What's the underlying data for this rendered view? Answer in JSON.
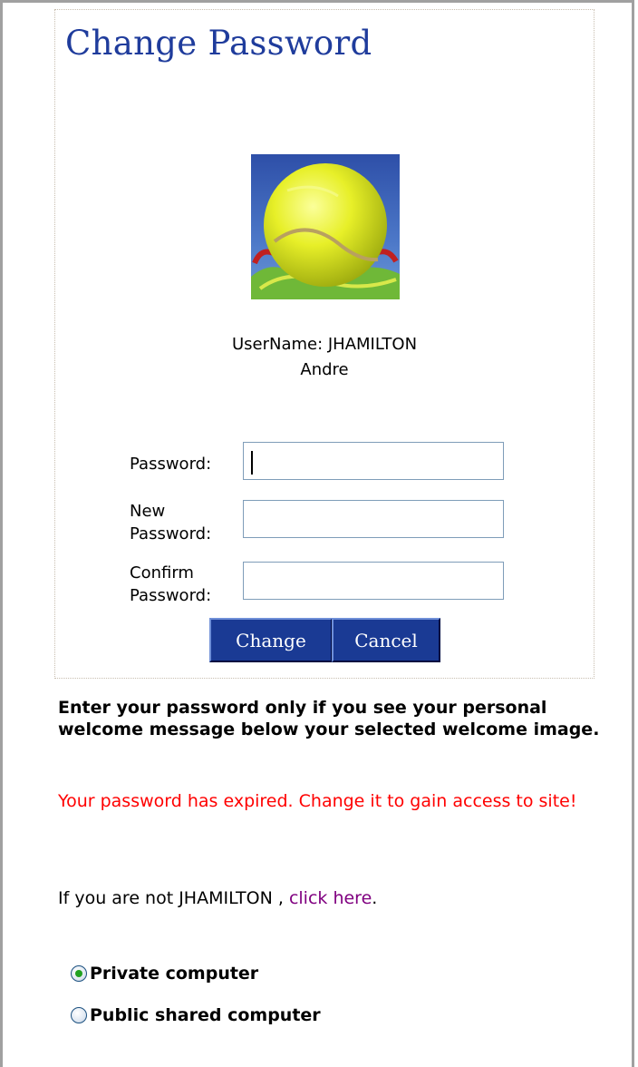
{
  "page": {
    "title": "Change Password"
  },
  "welcome": {
    "image_icon": "tennis-ball-image",
    "username_line": "UserName: JHAMILTON",
    "fullname": "Andre"
  },
  "form": {
    "password_label": "Password:",
    "new_password_label_1": "New",
    "new_password_label_2": "Password:",
    "confirm_password_label_1": "Confirm",
    "confirm_password_label_2": "Password:",
    "password_value": "",
    "new_password_value": "",
    "confirm_password_value": ""
  },
  "buttons": {
    "change_label": "Change",
    "cancel_label": "Cancel"
  },
  "messages": {
    "instructions": "Enter your password only if you see your personal welcome message below your selected welcome image.",
    "expired": "Your password has expired. Change it to gain access to site!",
    "not_user_prefix": "If you are not JHAMILTON , ",
    "not_user_link": "click here",
    "not_user_suffix": "."
  },
  "computer_type": {
    "options": [
      "Private computer",
      "Public shared computer"
    ],
    "selected": "Private computer"
  },
  "colors": {
    "title": "#1f3c9c",
    "button_bg": "#1a3a94",
    "error": "#ff0000",
    "link": "#800080",
    "radio_selected": "#21a121"
  }
}
